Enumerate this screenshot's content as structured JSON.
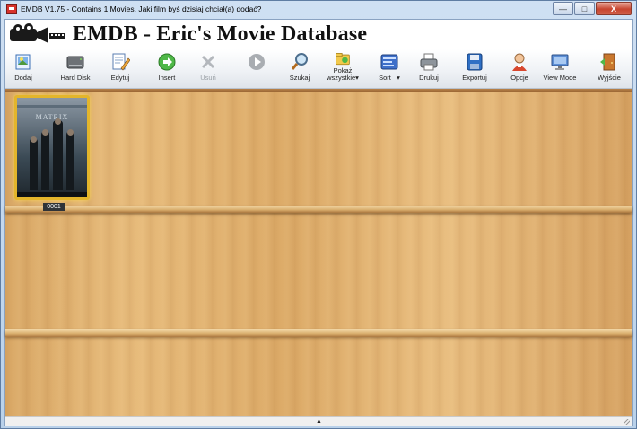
{
  "window": {
    "title": "EMDB V1.75 - Contains 1 Movies. Jaki film byś dzisiaj chciał(a) dodać?",
    "buttons": {
      "minimize": "—",
      "maximize": "□",
      "close": "X"
    }
  },
  "banner": {
    "title": "EMDB - Eric's Movie Database"
  },
  "toolbar": {
    "items": [
      {
        "label": "Dodaj",
        "icon": "add-picture-icon",
        "enabled": true
      },
      {
        "label": "Hard Disk",
        "icon": "hard-disk-icon",
        "enabled": true
      },
      {
        "label": "Edytuj",
        "icon": "edit-icon",
        "enabled": true
      },
      {
        "label": "Insert",
        "icon": "insert-green-arrow-icon",
        "enabled": true
      },
      {
        "label": "Usuń",
        "icon": "delete-icon",
        "enabled": false
      },
      {
        "label": "",
        "icon": "play-icon",
        "enabled": false
      },
      {
        "label": "Szukaj",
        "icon": "search-icon",
        "enabled": true
      },
      {
        "label": "Pokaż",
        "label2": "wszystkie",
        "icon": "show-all-folder-icon",
        "enabled": true,
        "dropdown": true
      },
      {
        "label": "Sort",
        "icon": "sort-icon",
        "enabled": true,
        "dropdown": true
      },
      {
        "label": "Drukuj",
        "icon": "printer-icon",
        "enabled": true
      },
      {
        "label": "Exportuj",
        "icon": "export-disk-icon",
        "enabled": true
      },
      {
        "label": "Opcje",
        "icon": "options-user-icon",
        "enabled": true
      },
      {
        "label": "View Mode",
        "icon": "monitor-icon",
        "enabled": true
      },
      {
        "label": "Wyjście",
        "icon": "exit-door-icon",
        "enabled": true
      }
    ]
  },
  "shelf": {
    "movies": [
      {
        "number": "0001",
        "cover_title": "MATRIX"
      }
    ]
  },
  "status": {
    "arrow": "▲"
  }
}
